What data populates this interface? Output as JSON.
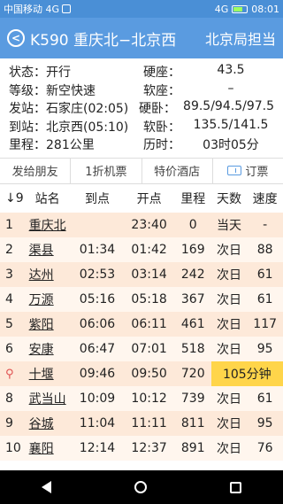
{
  "statusbar": {
    "carrier": "中国移动 4G",
    "network": "4G",
    "time": "08:01"
  },
  "header": {
    "train_title": "K590 重庆北−北京西",
    "bureau": "北京局担当"
  },
  "info": {
    "rows": [
      {
        "left": "状态：开行",
        "rk": "硬座：",
        "rv": "43.5"
      },
      {
        "left": "等级：新空快速",
        "rk": "软座：",
        "rv": "–"
      },
      {
        "left": "发站：石家庄(02:05)",
        "rk": "硬卧：",
        "rv": "89.5/94.5/97.5"
      },
      {
        "left": "到站：北京西(05:10)",
        "rk": "软卧：",
        "rv": "135.5/141.5"
      },
      {
        "left": "里程：281公里",
        "rk": "历时：",
        "rv": "03时05分"
      }
    ]
  },
  "actions": [
    {
      "label": "发给朋友",
      "icon": null
    },
    {
      "label": "1折机票",
      "icon": null
    },
    {
      "label": "特价酒店",
      "icon": null
    },
    {
      "label": "订票",
      "icon": "ticket-icon"
    }
  ],
  "table": {
    "sort_header": "↓9",
    "columns": [
      "站名",
      "到点",
      "开点",
      "里程",
      "天数",
      "速度"
    ],
    "rows": [
      {
        "no": "1",
        "station": "重庆北",
        "arrive": "",
        "depart": "23:40",
        "dist": "0",
        "day": "当天",
        "speed": "-"
      },
      {
        "no": "2",
        "station": "渠县",
        "arrive": "01:34",
        "depart": "01:42",
        "dist": "169",
        "day": "次日",
        "speed": "88"
      },
      {
        "no": "3",
        "station": "达州",
        "arrive": "02:53",
        "depart": "03:14",
        "dist": "242",
        "day": "次日",
        "speed": "61"
      },
      {
        "no": "4",
        "station": "万源",
        "arrive": "05:16",
        "depart": "05:18",
        "dist": "367",
        "day": "次日",
        "speed": "61"
      },
      {
        "no": "5",
        "station": "紫阳",
        "arrive": "06:06",
        "depart": "06:11",
        "dist": "461",
        "day": "次日",
        "speed": "117"
      },
      {
        "no": "6",
        "station": "安康",
        "arrive": "06:47",
        "depart": "07:01",
        "dist": "518",
        "day": "次日",
        "speed": "95"
      },
      {
        "no": "",
        "station": "十堰",
        "arrive": "09:46",
        "depart": "09:50",
        "dist": "720",
        "day": "105分钟",
        "speed": "",
        "highlight": true
      },
      {
        "no": "8",
        "station": "武当山",
        "arrive": "10:09",
        "depart": "10:12",
        "dist": "739",
        "day": "次日",
        "speed": "61"
      },
      {
        "no": "9",
        "station": "谷城",
        "arrive": "11:04",
        "depart": "11:11",
        "dist": "811",
        "day": "次日",
        "speed": "95"
      },
      {
        "no": "10",
        "station": "襄阳",
        "arrive": "12:14",
        "depart": "12:37",
        "dist": "891",
        "day": "次日",
        "speed": "76"
      }
    ]
  },
  "colors": {
    "accent": "#5a9be0",
    "row_odd": "#fde9d9",
    "row_even": "#fff6ee",
    "highlight": "#ffd54a"
  }
}
